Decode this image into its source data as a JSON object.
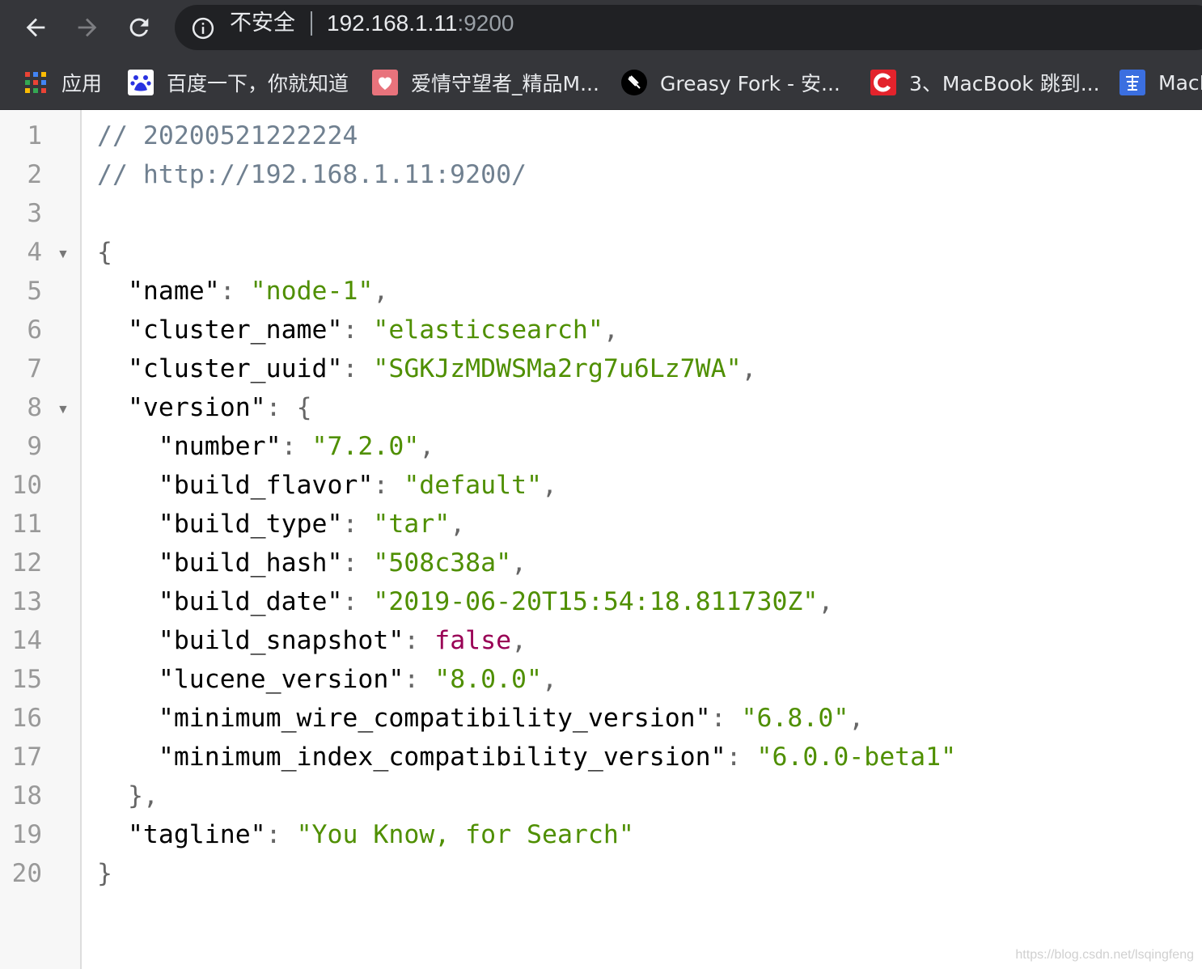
{
  "browser": {
    "omnibox": {
      "security_label": "不安全",
      "host": "192.168.1.11",
      "port": ":9200"
    },
    "bookmarks": [
      {
        "label": "应用",
        "icon": "apps-grid-icon"
      },
      {
        "label": "百度一下，你就知道",
        "icon": "baidu-paw-icon"
      },
      {
        "label": "爱情守望者_精品M...",
        "icon": "heart-icon"
      },
      {
        "label": "Greasy Fork - 安...",
        "icon": "greasy-fork-icon"
      },
      {
        "label": "3、MacBook 跳到...",
        "icon": "csdn-c-icon"
      },
      {
        "label": "MacB",
        "icon": "feng-icon"
      }
    ]
  },
  "viewer": {
    "line_numbers": [
      "1",
      "2",
      "3",
      "4",
      "5",
      "6",
      "7",
      "8",
      "9",
      "10",
      "11",
      "12",
      "13",
      "14",
      "15",
      "16",
      "17",
      "18",
      "19",
      "20"
    ],
    "comments": {
      "timestamp": "// 20200521222224",
      "url": "// http://192.168.1.11:9200/"
    },
    "json": {
      "open_brace": "{",
      "close_brace": "}",
      "name_key": "\"name\"",
      "name_value": "\"node-1\"",
      "cluster_name_key": "\"cluster_name\"",
      "cluster_name_value": "\"elasticsearch\"",
      "cluster_uuid_key": "\"cluster_uuid\"",
      "cluster_uuid_value": "\"SGKJzMDWSMa2rg7u6Lz7WA\"",
      "version_key": "\"version\"",
      "version_close": "},",
      "number_key": "\"number\"",
      "number_value": "\"7.2.0\"",
      "build_flavor_key": "\"build_flavor\"",
      "build_flavor_value": "\"default\"",
      "build_type_key": "\"build_type\"",
      "build_type_value": "\"tar\"",
      "build_hash_key": "\"build_hash\"",
      "build_hash_value": "\"508c38a\"",
      "build_date_key": "\"build_date\"",
      "build_date_value": "\"2019-06-20T15:54:18.811730Z\"",
      "build_snapshot_key": "\"build_snapshot\"",
      "build_snapshot_value": "false",
      "lucene_version_key": "\"lucene_version\"",
      "lucene_version_value": "\"8.0.0\"",
      "min_wire_key": "\"minimum_wire_compatibility_version\"",
      "min_wire_value": "\"6.8.0\"",
      "min_index_key": "\"minimum_index_compatibility_version\"",
      "min_index_value": "\"6.0.0-beta1\"",
      "tagline_key": "\"tagline\"",
      "tagline_value": "\"You Know, for Search\""
    }
  },
  "watermark": "https://blog.csdn.net/lsqingfeng",
  "colors": {
    "toolbar_bg": "#35363a",
    "omnibox_bg": "#202124",
    "string": "#4f8f00",
    "boolean": "#990055",
    "comment": "#708090"
  }
}
